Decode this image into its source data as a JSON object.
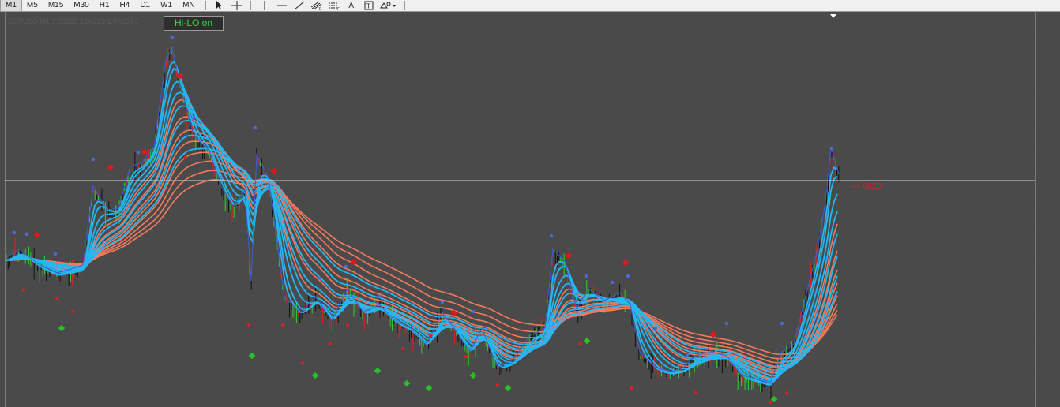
{
  "toolbar": {
    "timeframes": [
      "M1",
      "M5",
      "M15",
      "M30",
      "H1",
      "H4",
      "D1",
      "W1",
      "MN"
    ],
    "active_timeframe": "M1",
    "tools": [
      {
        "name": "cursor-arrow-icon"
      },
      {
        "name": "crosshair-icon"
      },
      {
        "name": "vertical-line-icon"
      },
      {
        "name": "horizontal-line-icon"
      },
      {
        "name": "trendline-icon"
      },
      {
        "name": "equidistant-channel-icon"
      },
      {
        "name": "fibonacci-icon"
      },
      {
        "name": "text-tool-icon",
        "label": "A"
      },
      {
        "name": "text-label-icon"
      },
      {
        "name": "shapes-dropdown-icon"
      }
    ]
  },
  "chart": {
    "symbol_line": "EURUSD,M1  1.00228 1.00229 1.00228 1",
    "hilo_button": "Hi-LO on",
    "countdown": "<< 00:53",
    "colors": {
      "background": "#4a4a4a",
      "bid_line": "#d8d8d8",
      "fast_ribbon": "#25b7f5",
      "slow_ribbon": "#f57a5e",
      "high_dot": "#4a6ae0",
      "red_diamond": "#e01818",
      "green_diamond": "#28c228",
      "countdown": "#d42424",
      "hilo_text": "#3bd83b"
    }
  }
}
